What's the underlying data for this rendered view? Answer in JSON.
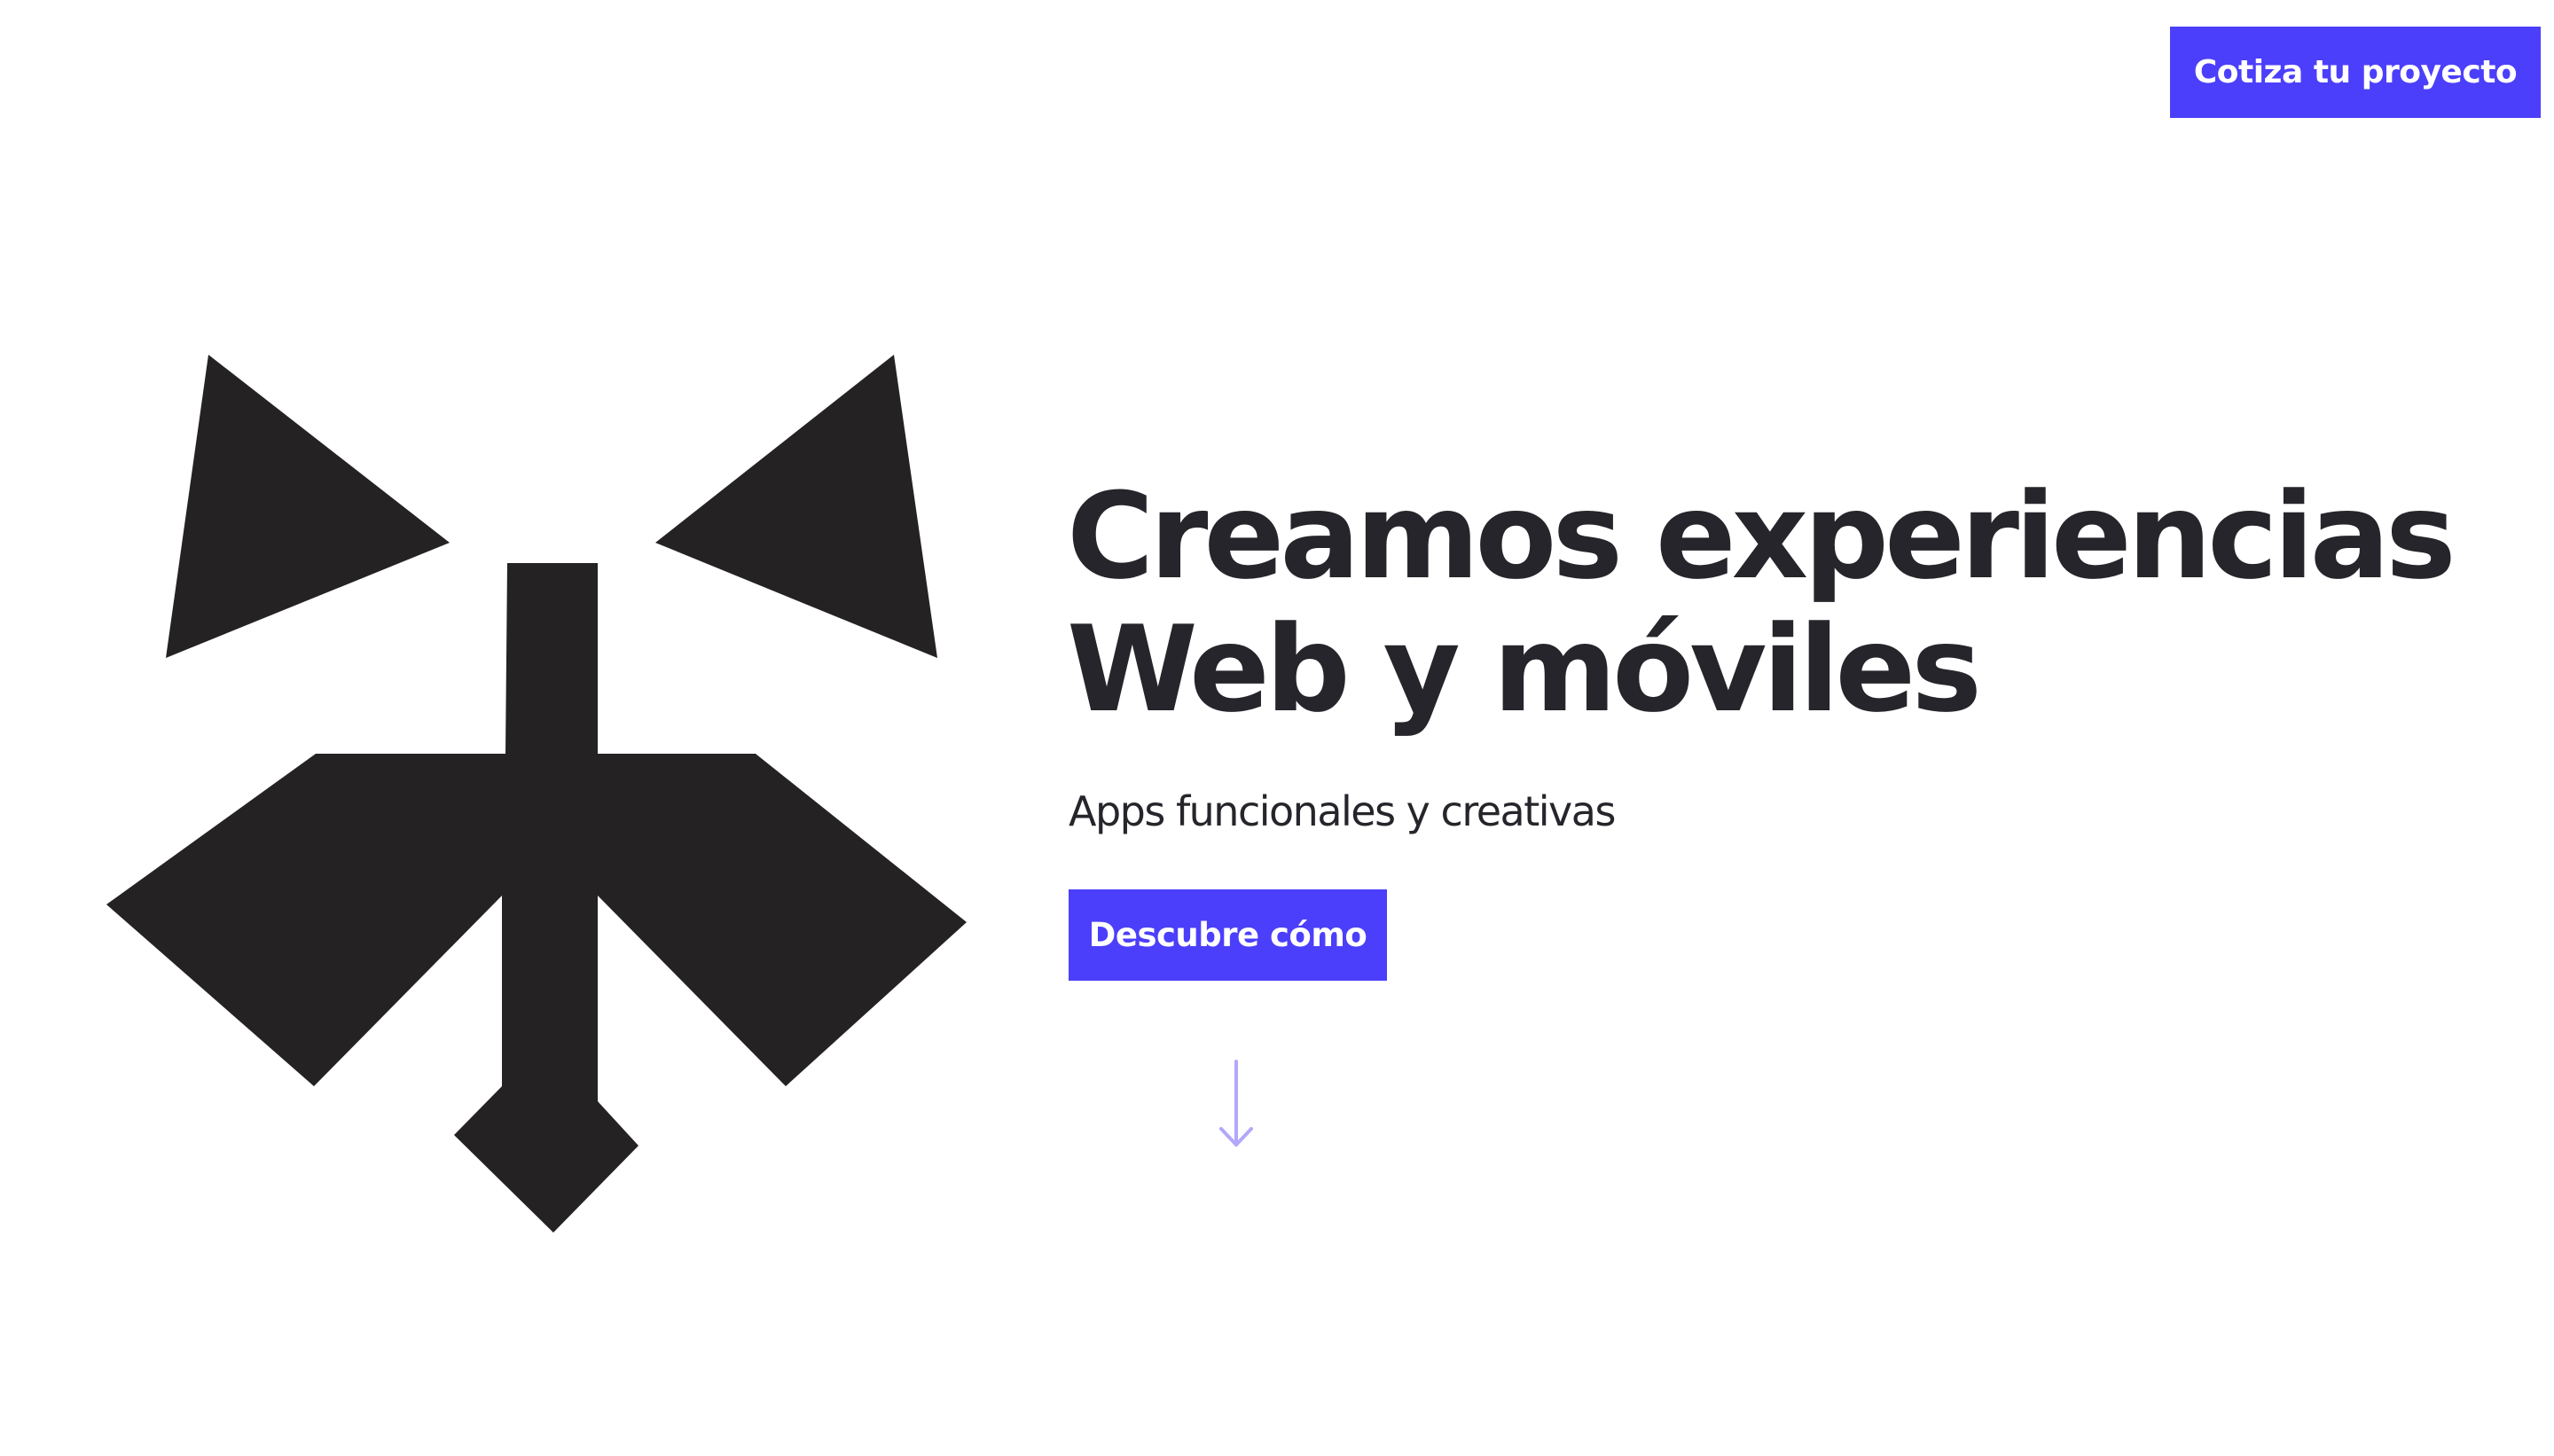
{
  "header": {
    "cta_label": "Cotiza tu proyecto"
  },
  "hero": {
    "title_line1": "Creamos experiencias",
    "title_line2": "Web y móviles",
    "subtitle": "Apps funcionales y creativas",
    "cta_label": "Descubre cómo",
    "scroll_icon": "arrow-down-icon"
  },
  "brand": {
    "logo": "raccoon-logo",
    "logo_color": "#252223"
  },
  "colors": {
    "accent": "#4b3ffb",
    "text": "#26252b",
    "arrow": "#b1a8fb",
    "background": "#ffffff"
  }
}
